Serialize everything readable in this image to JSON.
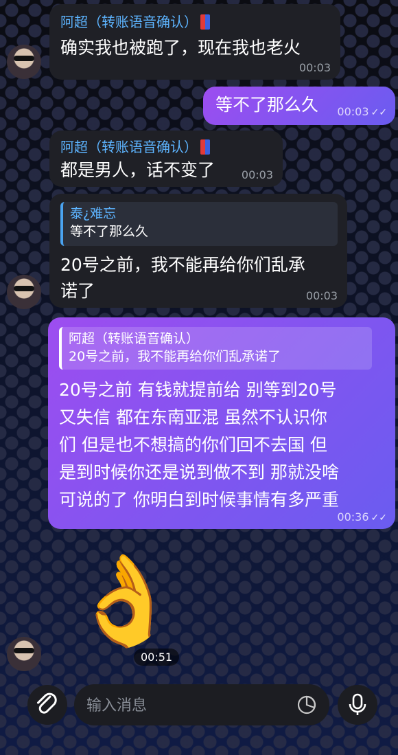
{
  "messages": [
    {
      "sender": "阿超（转账语音确认）",
      "text": "确实我也被跑了，现在我也老火",
      "time": "00:03"
    },
    {
      "text": "等不了那么久",
      "time": "00:03"
    },
    {
      "sender": "阿超（转账语音确认）",
      "text": "都是男人，话不变了",
      "time": "00:03"
    },
    {
      "reply_name": "泰¿难忘",
      "reply_text": "等不了那么久",
      "text_lines": [
        "20号之前，我不能再给你们乱承",
        "诺了"
      ],
      "time": "00:03"
    },
    {
      "reply_name": "阿超（转账语音确认）",
      "reply_text": "20号之前，我不能再给你们乱承诺了",
      "text_lines": [
        "20号之前 有钱就提前给 别等到20号",
        "又失信 都在东南亚混 虽然不认识你",
        "们 但是也不想搞的你们回不去国 但",
        "是到时候你还是说到做不到 那就没啥",
        "可说的了 你明白到时候事情有多严重"
      ],
      "time": "00:36"
    },
    {
      "emoji": "👌",
      "time": "00:51"
    }
  ],
  "input": {
    "placeholder": "输入消息"
  },
  "icons": {
    "attach": "paperclip-icon",
    "sticker": "sticker-icon",
    "mic": "microphone-icon",
    "read": "double-check-icon"
  }
}
